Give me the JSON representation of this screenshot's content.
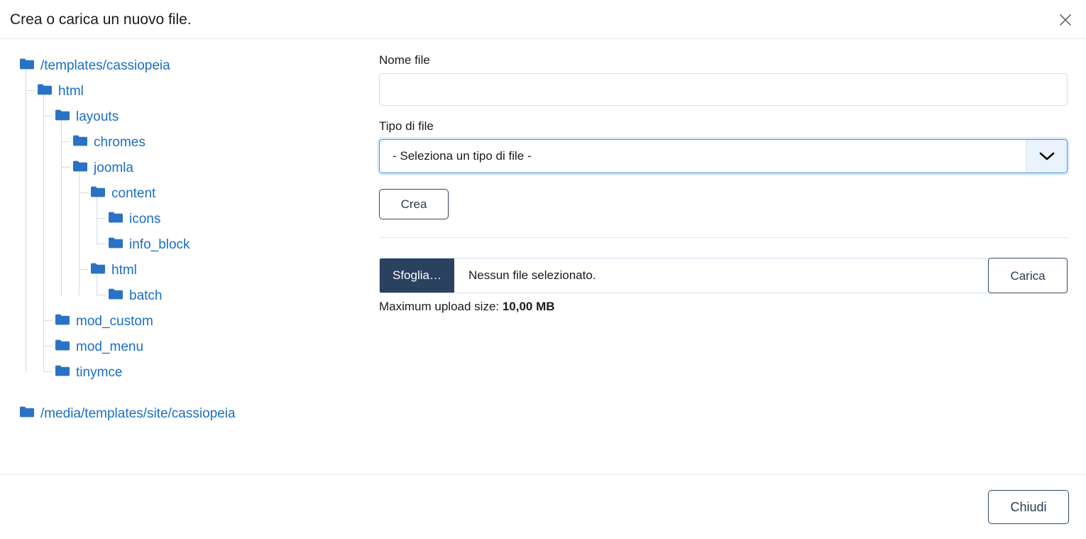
{
  "header": {
    "title": "Crea o carica un nuovo file.",
    "close_icon": "close-icon"
  },
  "tree": {
    "folder_icon": "folder-icon",
    "roots": [
      {
        "label": "/templates/cassiopeia",
        "children": [
          {
            "label": "html",
            "children": [
              {
                "label": "layouts",
                "children": [
                  {
                    "label": "chromes",
                    "children": []
                  },
                  {
                    "label": "joomla",
                    "children": [
                      {
                        "label": "content",
                        "children": [
                          {
                            "label": "icons",
                            "children": []
                          },
                          {
                            "label": "info_block",
                            "children": []
                          }
                        ]
                      },
                      {
                        "label": "html",
                        "children": [
                          {
                            "label": "batch",
                            "children": []
                          }
                        ]
                      }
                    ]
                  }
                ]
              },
              {
                "label": "mod_custom",
                "children": []
              },
              {
                "label": "mod_menu",
                "children": []
              },
              {
                "label": "tinymce",
                "children": []
              }
            ]
          }
        ]
      },
      {
        "label": "/media/templates/site/cassiopeia",
        "children": []
      }
    ]
  },
  "form": {
    "filename_label": "Nome file",
    "filename_value": "",
    "filename_placeholder": "",
    "filetype_label": "Tipo di file",
    "filetype_selected": "- Seleziona un tipo di file -",
    "filetype_arrow_icon": "chevron-down-icon",
    "create_button": "Crea"
  },
  "upload": {
    "browse_button": "Sfoglia…",
    "file_status": "Nessun file selezionato.",
    "upload_button": "Carica",
    "max_size_prefix": "Maximum upload size: ",
    "max_size_value": "10,00 MB"
  },
  "footer": {
    "close_button": "Chiudi"
  },
  "colors": {
    "link": "#1a6ec4",
    "folder": "#2a72c4",
    "browse_bg": "#2b4160",
    "focus_border": "#3f95e8",
    "button_border": "#34495c"
  }
}
